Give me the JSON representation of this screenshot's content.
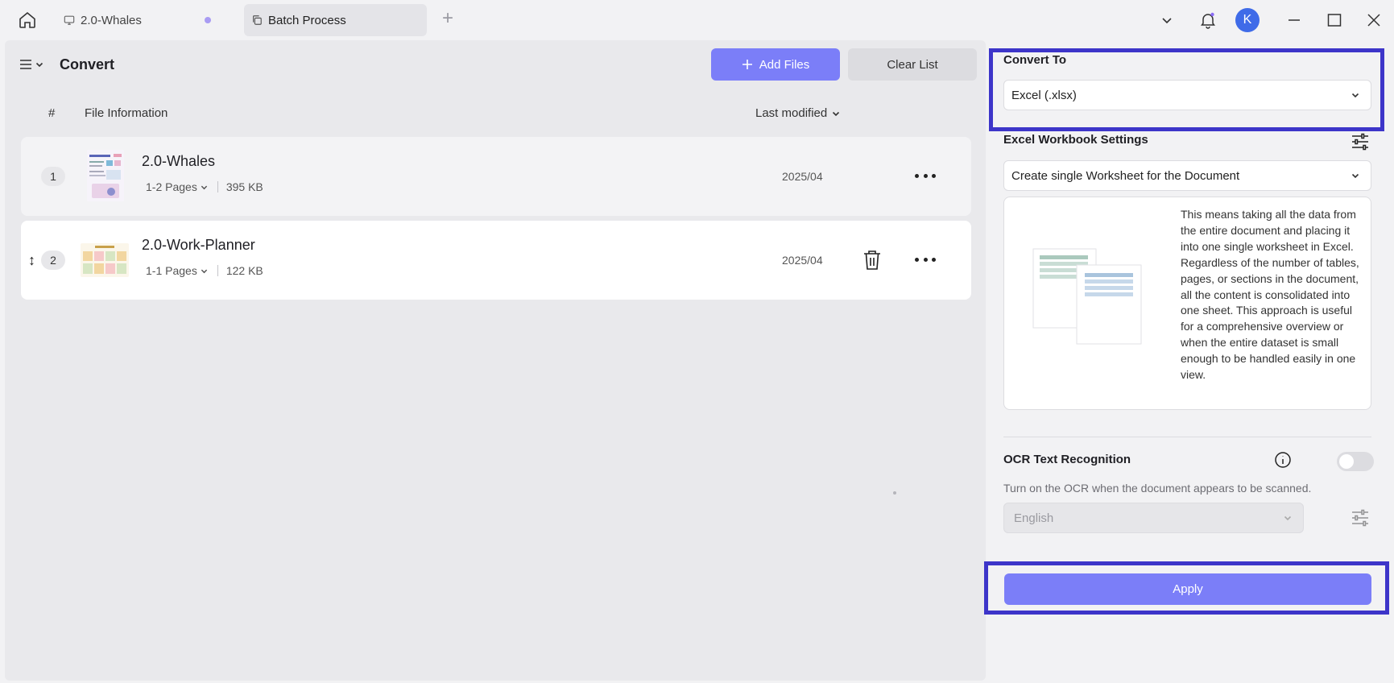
{
  "titlebar": {
    "tabs": [
      {
        "label": "2.0-Whales",
        "icon": "monitor-icon"
      },
      {
        "label": "Batch Process",
        "icon": "copy-icon"
      }
    ],
    "avatar_initial": "K"
  },
  "left": {
    "title": "Convert",
    "add_files_label": "Add Files",
    "clear_list_label": "Clear List",
    "columns": {
      "num": "#",
      "info": "File Information",
      "modified": "Last modified"
    },
    "files": [
      {
        "index": "1",
        "name": "2.0-Whales",
        "pages": "1-2 Pages",
        "size": "395 KB",
        "date": "2025/04"
      },
      {
        "index": "2",
        "name": "2.0-Work-Planner",
        "pages": "1-1 Pages",
        "size": "122 KB",
        "date": "2025/04"
      }
    ]
  },
  "right": {
    "convert_to_label": "Convert To",
    "convert_to_value": "Excel (.xlsx)",
    "workbook_settings_label": "Excel Workbook Settings",
    "worksheet_mode": "Create single Worksheet for the Document",
    "worksheet_description": "This means taking all the data from the entire document and placing it into one single worksheet in Excel. Regardless of the number of tables, pages, or sections in the document, all the content is consolidated into one sheet. This approach is useful for a comprehensive overview or when the entire dataset is small enough to be handled easily in one view.",
    "ocr_label": "OCR Text Recognition",
    "ocr_enabled": false,
    "ocr_hint": "Turn on the OCR when the document appears to be scanned.",
    "ocr_language": "English",
    "apply_label": "Apply"
  },
  "colors": {
    "accent": "#7b7ef8",
    "highlight": "#3d35c9",
    "avatar": "#3f6be8"
  }
}
